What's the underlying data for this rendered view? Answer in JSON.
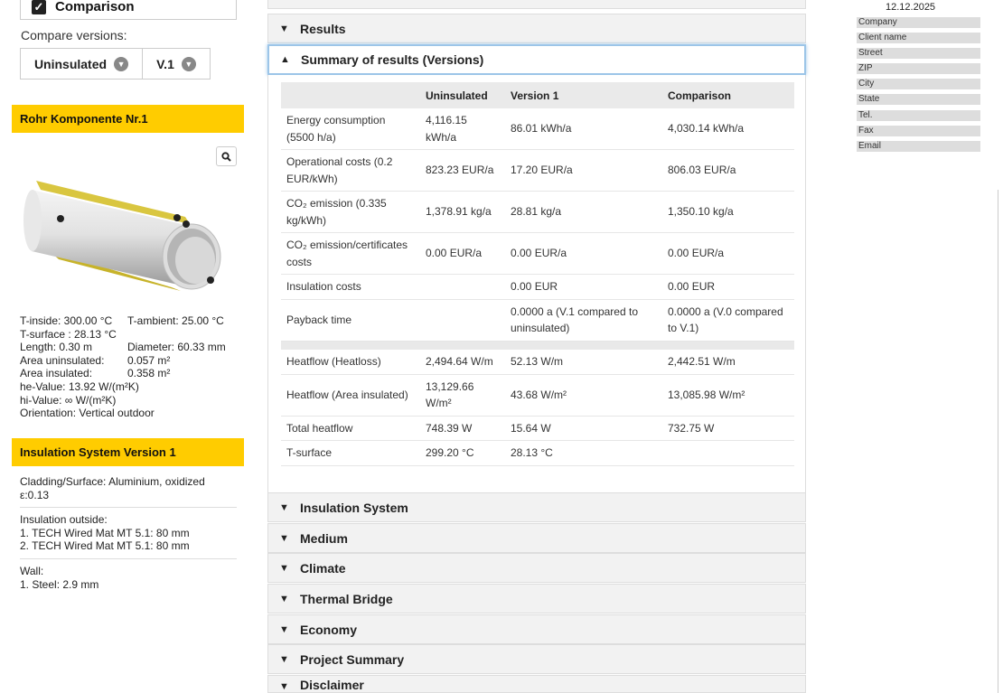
{
  "comparison": {
    "label": "Comparison",
    "checked": true
  },
  "compare_versions": {
    "label": "Compare versions:",
    "left_value": "Uninsulated",
    "right_value": "V.1"
  },
  "component": {
    "title": "Rohr Komponente Nr.1",
    "specs": [
      [
        "T-inside: 300.00 °C",
        "T-ambient: 25.00 °C"
      ],
      [
        "T-surface : 28.13 °C",
        ""
      ],
      [
        "Length: 0.30 m",
        "Diameter: 60.33 mm"
      ],
      [
        "Area uninsulated:",
        "0.057 m²"
      ],
      [
        "Area insulated:",
        "0.358 m²"
      ],
      [
        "he-Value: 13.92 W/(m²K)",
        ""
      ],
      [
        "hi-Value: ∞ W/(m²K)",
        ""
      ],
      [
        "Orientation: Vertical outdoor",
        ""
      ]
    ]
  },
  "insulation": {
    "title": "Insulation System Version 1",
    "cladding": [
      "Cladding/Surface: Aluminium, oxidized",
      "ε:0.13"
    ],
    "outside": [
      "Insulation outside:",
      "1. TECH Wired Mat MT 5.1: 80 mm",
      "2. TECH Wired Mat MT 5.1: 80 mm"
    ],
    "wall": [
      "Wall:",
      "1. Steel: 2.9 mm"
    ]
  },
  "panels": {
    "results": "Results",
    "summary": "Summary of results (Versions)",
    "insulation_system": "Insulation System",
    "medium": "Medium",
    "climate": "Climate",
    "thermal_bridge": "Thermal Bridge",
    "economy": "Economy",
    "project_summary": "Project Summary",
    "disclaimer": "Disclaimer"
  },
  "table": {
    "headers": [
      "",
      "Uninsulated",
      "Version 1",
      "Comparison"
    ],
    "rows": [
      [
        "Energy consumption (5500 h/a)",
        "4,116.15 kWh/a",
        "86.01 kWh/a",
        "4,030.14 kWh/a"
      ],
      [
        "Operational costs (0.2 EUR/kWh)",
        "823.23 EUR/a",
        "17.20 EUR/a",
        "806.03 EUR/a"
      ],
      [
        "CO₂ emission (0.335 kg/kWh)",
        "1,378.91 kg/a",
        "28.81 kg/a",
        "1,350.10 kg/a"
      ],
      [
        "CO₂ emission/certificates costs",
        "0.00 EUR/a",
        "0.00 EUR/a",
        "0.00 EUR/a"
      ],
      [
        "Insulation costs",
        "",
        "0.00 EUR",
        "0.00 EUR"
      ],
      [
        "Payback time",
        "",
        "0.0000 a (V.1 compared to uninsulated)",
        "0.0000 a (V.0 compared to V.1)"
      ]
    ],
    "rows2": [
      [
        "Heatflow (Heatloss)",
        "2,494.64 W/m",
        "52.13 W/m",
        "2,442.51 W/m"
      ],
      [
        "Heatflow (Area insulated)",
        "13,129.66 W/m²",
        "43.68 W/m²",
        "13,085.98 W/m²"
      ],
      [
        "Total heatflow",
        "748.39 W",
        "15.64 W",
        "732.75 W"
      ],
      [
        "T-surface",
        "299.20 °C",
        "28.13 °C",
        ""
      ]
    ]
  },
  "right": {
    "date": "12.12.2025",
    "fields": [
      "Company",
      "Client name",
      "Street",
      "ZIP",
      "City",
      "State",
      "Tel.",
      "Fax",
      "Email"
    ]
  }
}
